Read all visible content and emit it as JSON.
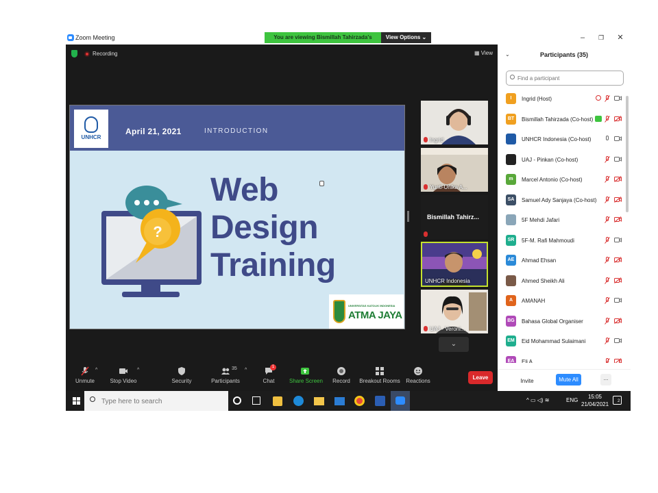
{
  "window": {
    "app_title": "Zoom Meeting",
    "viewing_banner": "You are viewing Bismillah Tahirzada's screen",
    "view_options": "View Options ⌄"
  },
  "meeting": {
    "recording_label": "Recording",
    "view_label": "View"
  },
  "slide": {
    "org_logo_text": "UNHCR",
    "date": "April 21, 2021",
    "section": "INTRODUCTION",
    "title_lines": [
      "Web",
      "Design",
      "Training"
    ],
    "partner_logo_text": "ATMA JAYA",
    "partner_logo_subtext": "UNIVERSITAS KATOLIK INDONESIA"
  },
  "videos": [
    {
      "name": "Ingrid"
    },
    {
      "name": "Yunti-Unika A..."
    },
    {
      "name": "Bismillah Tahirz..."
    },
    {
      "name": "UNHCR Indonesia"
    },
    {
      "name": "UAJ - Veroni..."
    }
  ],
  "toolbar": {
    "unmute": "Unmute",
    "stop_video": "Stop Video",
    "security": "Security",
    "participants": "Participants",
    "participants_count": "35",
    "chat": "Chat",
    "chat_badge": "1",
    "share_screen": "Share Screen",
    "record": "Record",
    "breakout_rooms": "Breakout Rooms",
    "reactions": "Reactions",
    "leave": "Leave"
  },
  "panel": {
    "title": "Participants (35)",
    "search_placeholder": "Find a participant",
    "participants": [
      {
        "initials": "I",
        "name": "Ingrid (Host)",
        "color": "#f0a020"
      },
      {
        "initials": "BT",
        "name": "Bismillah Tahirzada (Co-host)",
        "color": "#f0a020"
      },
      {
        "initials": "",
        "name": "UNHCR Indonesia (Co-host)",
        "color": "#1f5aa6"
      },
      {
        "initials": "",
        "name": "UAJ - Pinkan (Co-host)",
        "color": "#222222"
      },
      {
        "initials": "m",
        "name": "Marcel Antonio (Co-host)",
        "color": "#59a83a"
      },
      {
        "initials": "SA",
        "name": "Samuel Ady Sanjaya (Co-host)",
        "color": "#3c4f66"
      },
      {
        "initials": "",
        "name": "5F Mehdi Jafari",
        "color": "#8aa6b8"
      },
      {
        "initials": "SR",
        "name": "5F-M. Rafi Mahmoudi",
        "color": "#1fae8e"
      },
      {
        "initials": "AE",
        "name": "Ahmad Ehsan",
        "color": "#2b8ad8"
      },
      {
        "initials": "",
        "name": "Ahmed Sheikh Ali",
        "color": "#7a5a48"
      },
      {
        "initials": "A",
        "name": "AMANAH",
        "color": "#e0641c"
      },
      {
        "initials": "BG",
        "name": "Bahasa Global Organiser",
        "color": "#b04ab8"
      },
      {
        "initials": "EM",
        "name": "Eid Mohammad Sulaimani",
        "color": "#1fae8e"
      },
      {
        "initials": "EA",
        "name": "Eli A",
        "color": "#b04ab8"
      }
    ],
    "invite": "Invite",
    "mute_all": "Mute All",
    "more": "..."
  },
  "taskbar": {
    "search_placeholder": "Type here to search",
    "language": "ENG",
    "time": "15:05",
    "date": "21/04/2021",
    "notification_count": "2"
  }
}
